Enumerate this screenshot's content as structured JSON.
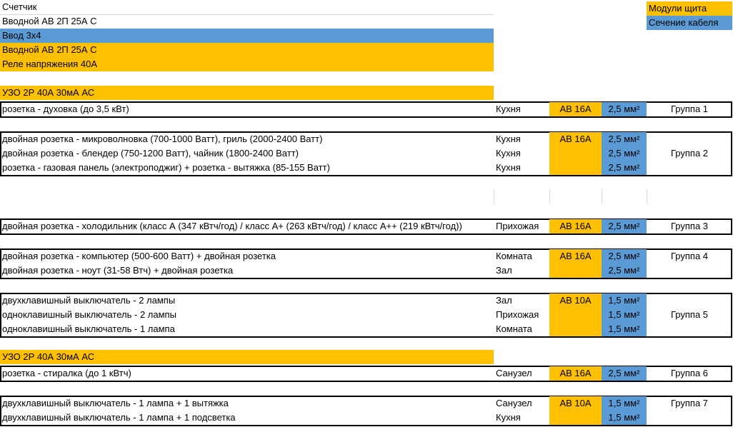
{
  "top_rows": [
    "Счетчик",
    "Вводной АВ 2П 25А С",
    "Ввод 3х4",
    "Вводной АВ 2П 25А С",
    "Реле напряжения 40А"
  ],
  "legend": {
    "modules": "Модули щита",
    "cable": "Сечение кабеля"
  },
  "uzo_label": "УЗО 2Р 40А 30мА АС",
  "groups": [
    {
      "label": "Группа 1",
      "breaker": "АВ 16А",
      "rows": [
        {
          "desc": "розетка - духовка (до 3,5 кВт)",
          "room": "Кухня",
          "cable": "2,5 мм²"
        }
      ]
    },
    {
      "label": "Группа 2",
      "breaker": "АВ 16А",
      "rows": [
        {
          "desc": "двойная розетка - микроволновка (700-1000 Ватт), гриль (2000-2400 Ватт)",
          "room": "Кухня",
          "cable": "2,5 мм²"
        },
        {
          "desc": "двойная розетка - блендер (750-1200 Ватт), чайник (1800-2400 Ватт)",
          "room": "Кухня",
          "cable": "2,5 мм²"
        },
        {
          "desc": "розетка - газовая панель (электроподжиг) + розетка - вытяжка (85-155 Ватт)",
          "room": "Кухня",
          "cable": "2,5 мм²"
        }
      ]
    },
    {
      "label": "Группа 3",
      "breaker": "АВ 16А",
      "rows": [
        {
          "desc": "двойная розетка - холодильник (класс А (347 кВтч/год) / класс А+ (263 кВтч/год) / класс А++ (219 кВтч/год))",
          "room": "Прихожая",
          "cable": "2,5 мм²"
        }
      ]
    },
    {
      "label": "Группа 4",
      "breaker": "АВ 16А",
      "rows": [
        {
          "desc": "двойная розетка - компьютер (500-600 Ватт) + двойная розетка",
          "room": "Комната",
          "cable": "2,5 мм²"
        },
        {
          "desc": "двойная розетка - ноут (31-58 Втч) + двойная розетка",
          "room": "Зал",
          "cable": "2,5 мм²"
        }
      ]
    },
    {
      "label": "Группа 5",
      "breaker": "АВ 10А",
      "rows": [
        {
          "desc": "двухклавишный выключатель - 2 лампы",
          "room": "Зал",
          "cable": "1,5 мм²"
        },
        {
          "desc": "одноклавишный выключатель - 2 лампы",
          "room": "Прихожая",
          "cable": "1,5 мм²"
        },
        {
          "desc": "одноклавишный выключатель - 1 лампа",
          "room": "Комната",
          "cable": "1,5 мм²"
        }
      ]
    },
    {
      "label": "Группа 6",
      "breaker": "АВ 16А",
      "rows": [
        {
          "desc": "розетка - стиралка (до 1 кВтч)",
          "room": "Санузел",
          "cable": "2,5 мм²"
        }
      ]
    },
    {
      "label": "Группа 7",
      "breaker": "АВ 10А",
      "rows": [
        {
          "desc": "двухклавишный выключатель - 1 лампа + 1 вытяжка",
          "room": "Санузел",
          "cable": "1,5 мм²"
        },
        {
          "desc": "двухклавишный выключатель - 1 лампа + 1 подсветка",
          "room": "Кухня",
          "cable": "1,5 мм²"
        }
      ]
    }
  ],
  "colors": {
    "orange": "#FFC000",
    "blue": "#5B9BD5"
  }
}
